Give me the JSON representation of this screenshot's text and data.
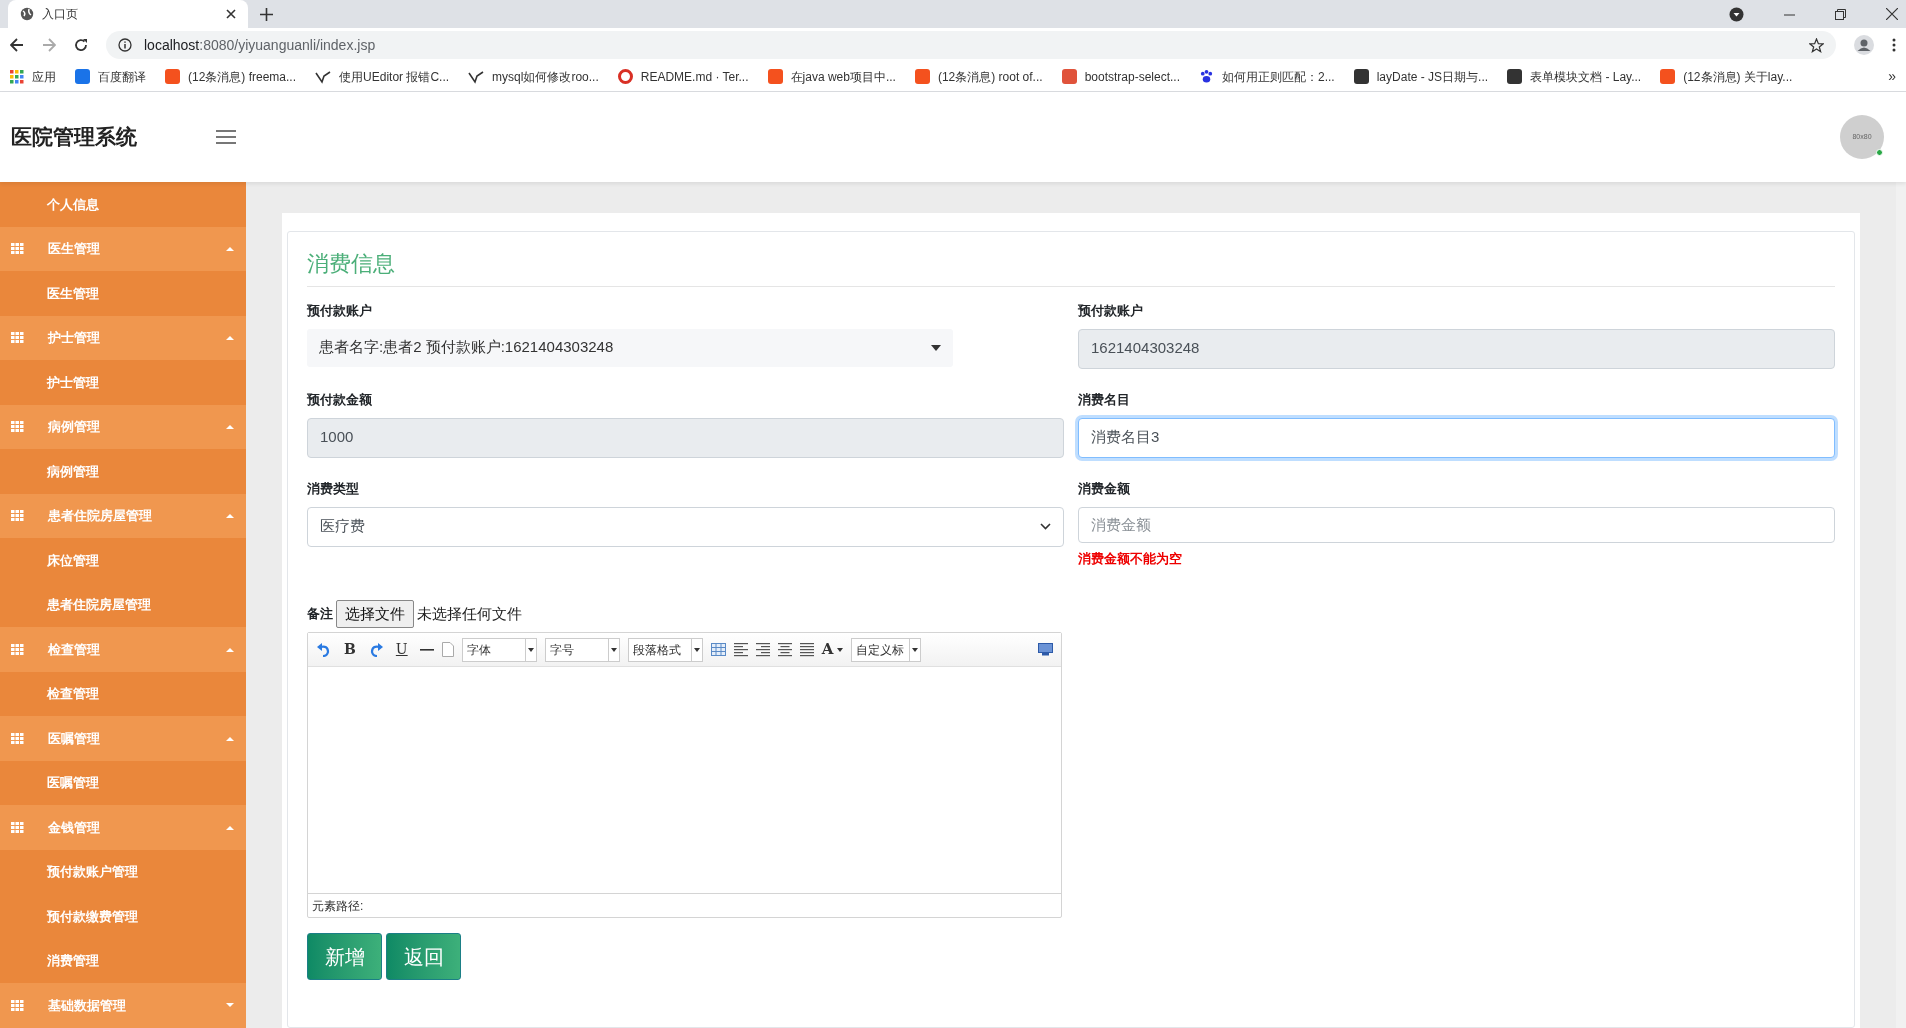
{
  "browser": {
    "tab_title": "入口页",
    "url_host": "localhost",
    "url_rest": ":8080/yiyuanguanli/index.jsp",
    "bookmarks": [
      {
        "label": "应用"
      },
      {
        "label": "百度翻译"
      },
      {
        "label": "(12条消息) freema..."
      },
      {
        "label": "使用UEditor 报错C..."
      },
      {
        "label": "mysql如何修改roo..."
      },
      {
        "label": "README.md · Ter..."
      },
      {
        "label": "在java web项目中..."
      },
      {
        "label": "(12条消息) root of..."
      },
      {
        "label": "bootstrap-select..."
      },
      {
        "label": "如何用正则匹配：2..."
      },
      {
        "label": "layDate - JS日期与..."
      },
      {
        "label": "表单模块文档 - Lay..."
      },
      {
        "label": "(12条消息) 关于lay..."
      }
    ],
    "more": "»"
  },
  "header": {
    "title": "医院管理系统",
    "avatar_text": "80x80",
    "online": true
  },
  "sidebar": {
    "items": [
      {
        "label": "个人信息",
        "kind": "link"
      },
      {
        "label": "医生管理",
        "kind": "group",
        "expanded": true,
        "children": [
          {
            "label": "医生管理"
          }
        ]
      },
      {
        "label": "护士管理",
        "kind": "group",
        "expanded": true,
        "children": [
          {
            "label": "护士管理"
          }
        ]
      },
      {
        "label": "病例管理",
        "kind": "group",
        "expanded": true,
        "children": [
          {
            "label": "病例管理"
          }
        ]
      },
      {
        "label": "患者住院房屋管理",
        "kind": "group",
        "expanded": true,
        "children": [
          {
            "label": "床位管理"
          },
          {
            "label": "患者住院房屋管理"
          }
        ]
      },
      {
        "label": "检查管理",
        "kind": "group",
        "expanded": true,
        "children": [
          {
            "label": "检查管理"
          }
        ]
      },
      {
        "label": "医嘱管理",
        "kind": "group",
        "expanded": true,
        "children": [
          {
            "label": "医嘱管理"
          }
        ]
      },
      {
        "label": "金钱管理",
        "kind": "group",
        "expanded": true,
        "children": [
          {
            "label": "预付款账户管理"
          },
          {
            "label": "预付款缴费管理"
          },
          {
            "label": "消费管理"
          }
        ]
      },
      {
        "label": "基础数据管理",
        "kind": "group",
        "expanded": false
      }
    ]
  },
  "form": {
    "title": "消费信息",
    "fields": [
      {
        "label": "预付款账户",
        "kind": "picker",
        "value": "患者名字:患者2 预付款账户:1621404303248"
      },
      {
        "label": "预付款账户",
        "kind": "readonly",
        "value": "1621404303248"
      },
      {
        "label": "预付款金额",
        "kind": "readonly",
        "value": "1000"
      },
      {
        "label": "消费名目",
        "kind": "input",
        "value": "消费名目3",
        "focused": true
      },
      {
        "label": "消费类型",
        "kind": "select",
        "value": "医疗费"
      },
      {
        "label": "消费金额",
        "kind": "input",
        "placeholder": "消费金额",
        "focused": false,
        "error": "消费金额不能为空"
      }
    ],
    "note": {
      "label": "备注",
      "file_button": "选择文件",
      "file_status": "未选择任何文件"
    },
    "editor": {
      "toolbar": [
        {
          "kind": "undo"
        },
        {
          "kind": "letter",
          "text": "B"
        },
        {
          "kind": "redo"
        },
        {
          "kind": "underline",
          "text": "U"
        },
        {
          "kind": "rule"
        },
        {
          "kind": "page"
        },
        {
          "kind": "dropdown",
          "text": "字体"
        },
        {
          "kind": "dropdown",
          "text": "字号"
        },
        {
          "kind": "dropdown",
          "text": "段落格式"
        },
        {
          "kind": "table"
        },
        {
          "kind": "align-left"
        },
        {
          "kind": "align-right"
        },
        {
          "kind": "align-center"
        },
        {
          "kind": "justify"
        },
        {
          "kind": "color",
          "text": "A"
        },
        {
          "kind": "dropdown",
          "text": "自定义标"
        }
      ],
      "path_label": "元素路径:"
    },
    "buttons": [
      {
        "label": "新增"
      },
      {
        "label": "返回"
      }
    ]
  }
}
